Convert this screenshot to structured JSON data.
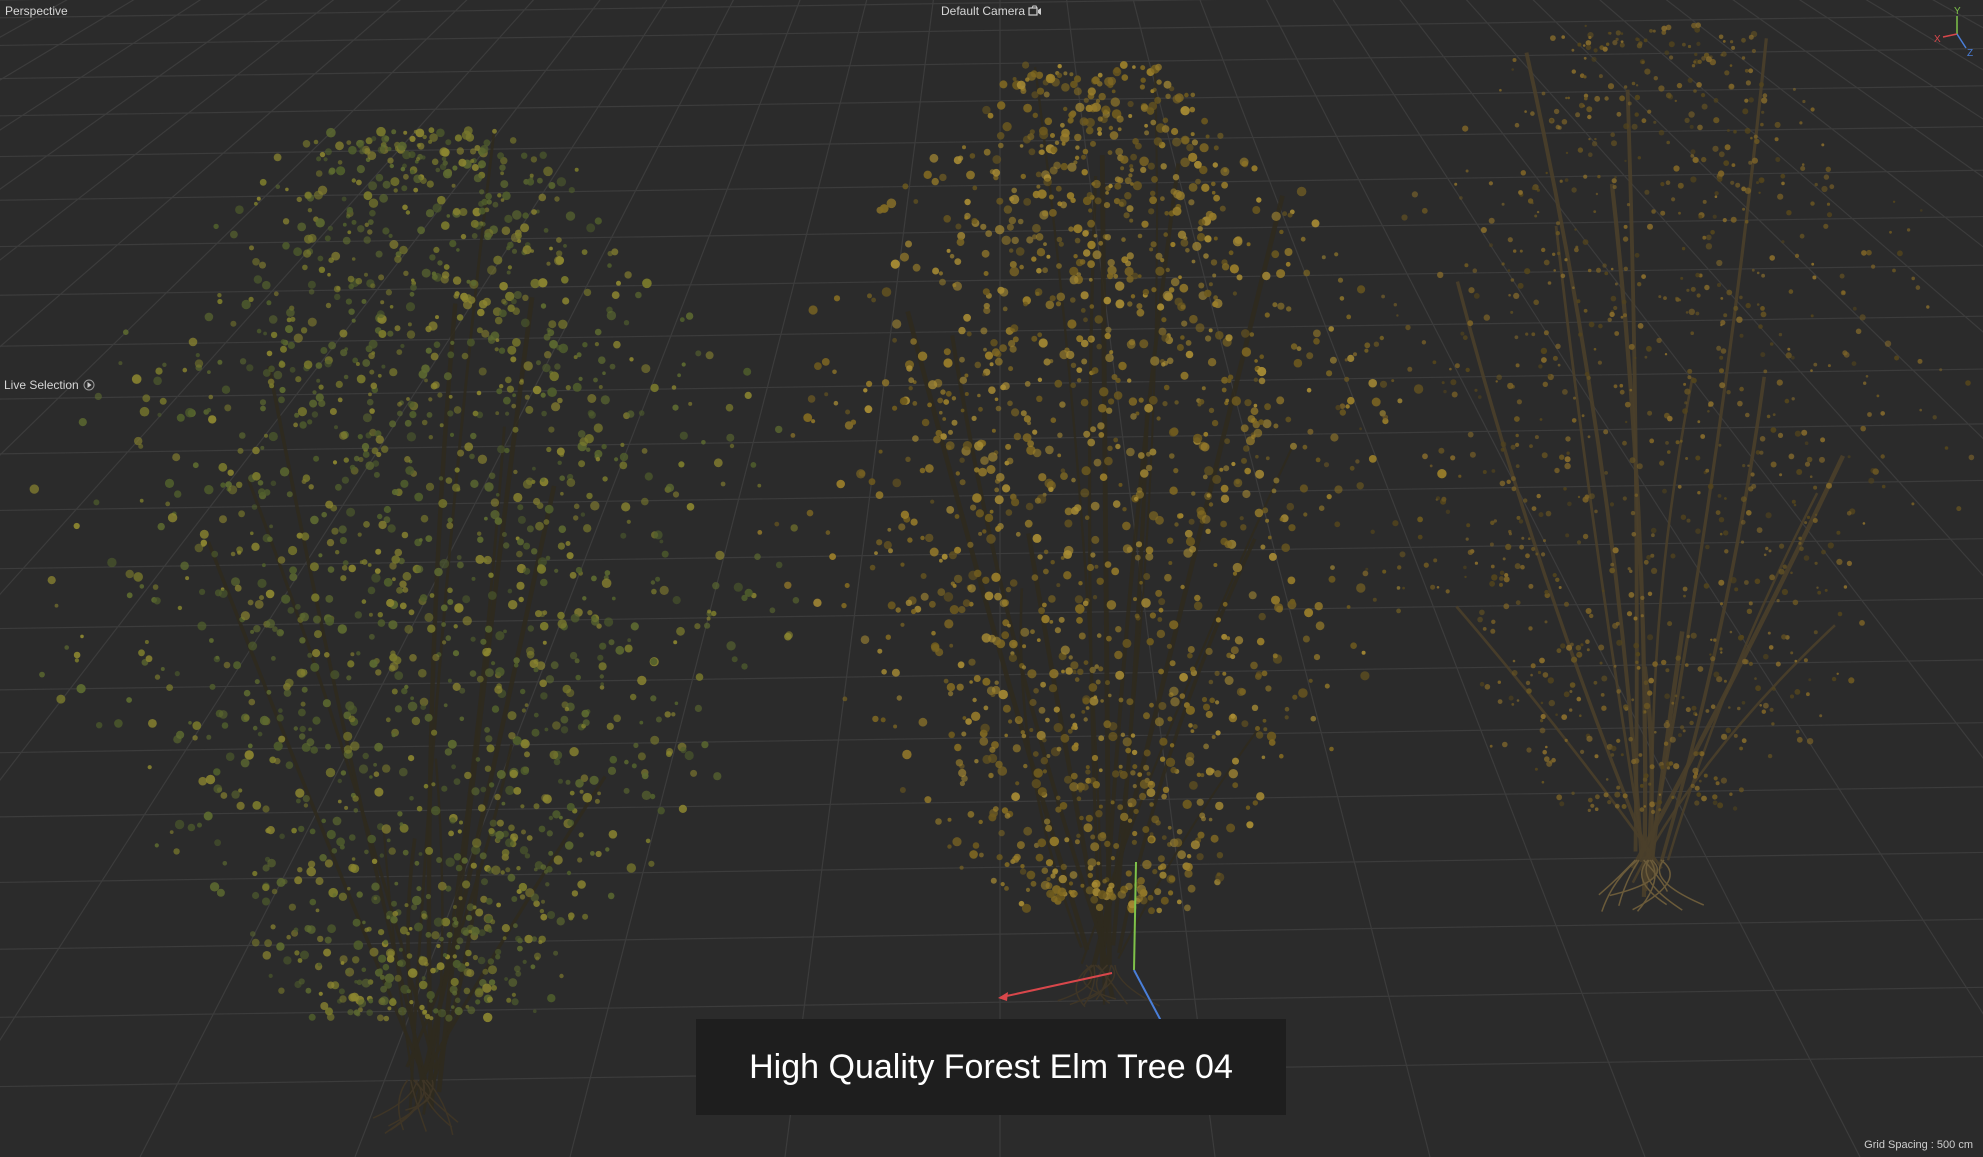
{
  "viewport": {
    "view_name": "Perspective",
    "camera_label": "Default Camera",
    "camera_icon": "camera-icon",
    "tool_label": "Live Selection",
    "tool_icon": "tool-arrow-icon",
    "grid_spacing": "Grid Spacing : 500 cm",
    "background_color": "#2b2b2b",
    "grid_color": "#3c3c3c"
  },
  "gizmo": {
    "x_label": "X",
    "y_label": "Y",
    "z_label": "Z",
    "x_color": "#d9474b",
    "y_color": "#7ec24a",
    "z_color": "#4a7fd9"
  },
  "banner": {
    "title": "High Quality Forest Elm Tree 04"
  },
  "trees": [
    {
      "name": "elm-tree-green",
      "foliage_colors": [
        "#5d6a30",
        "#7a7a2c",
        "#8c8630",
        "#4f5d2c"
      ]
    },
    {
      "name": "elm-tree-yellow",
      "foliage_colors": [
        "#9a7e2a",
        "#a88c34",
        "#826a22",
        "#6e5a1e"
      ]
    },
    {
      "name": "elm-tree-bare",
      "foliage_colors": [
        "#6a5622",
        "#7e6427",
        "#54451c",
        "#8a6e2c"
      ]
    }
  ]
}
